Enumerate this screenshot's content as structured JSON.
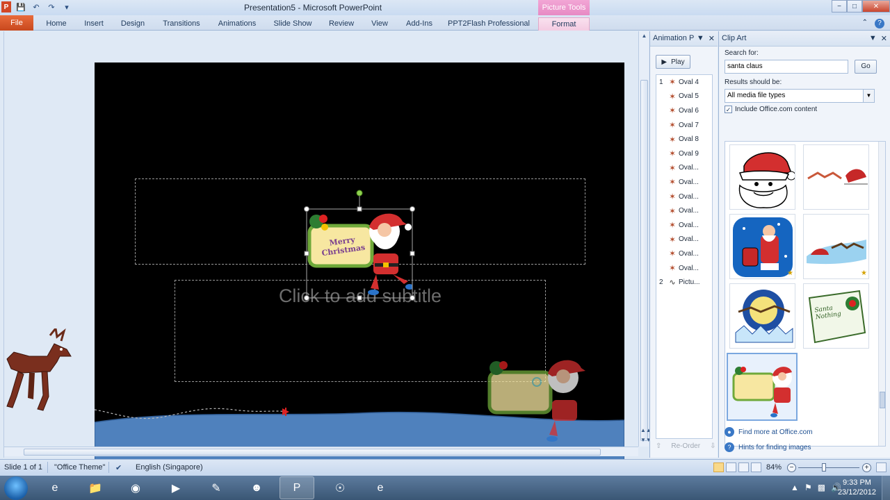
{
  "window": {
    "title": "Presentation5 - Microsoft PowerPoint",
    "contextual_tab_group": "Picture Tools",
    "minimize": "−",
    "maximize": "□",
    "close": "✕"
  },
  "ribbon": {
    "file": "File",
    "tabs": [
      "Home",
      "Insert",
      "Design",
      "Transitions",
      "Animations",
      "Slide Show",
      "Review",
      "View",
      "Add-Ins",
      "PPT2Flash Professional"
    ],
    "format_tab": "Format"
  },
  "slide": {
    "subtitle_placeholder": "Click to add subtitle",
    "clip_text": "Merry Christmas"
  },
  "animation_pane": {
    "title": "Animation P",
    "play": "Play",
    "items": [
      {
        "num": "1",
        "label": "Oval 4",
        "kind": "star"
      },
      {
        "num": "",
        "label": "Oval 5",
        "kind": "star"
      },
      {
        "num": "",
        "label": "Oval 6",
        "kind": "star"
      },
      {
        "num": "",
        "label": "Oval 7",
        "kind": "star"
      },
      {
        "num": "",
        "label": "Oval 8",
        "kind": "star"
      },
      {
        "num": "",
        "label": "Oval 9",
        "kind": "star"
      },
      {
        "num": "",
        "label": "Oval...",
        "kind": "star"
      },
      {
        "num": "",
        "label": "Oval...",
        "kind": "star"
      },
      {
        "num": "",
        "label": "Oval...",
        "kind": "star"
      },
      {
        "num": "",
        "label": "Oval...",
        "kind": "star"
      },
      {
        "num": "",
        "label": "Oval...",
        "kind": "star"
      },
      {
        "num": "",
        "label": "Oval...",
        "kind": "star"
      },
      {
        "num": "",
        "label": "Oval...",
        "kind": "star"
      },
      {
        "num": "",
        "label": "Oval...",
        "kind": "star"
      },
      {
        "num": "2",
        "label": "Pictu...",
        "kind": "path"
      }
    ],
    "reorder": "Re-Order"
  },
  "clip_art": {
    "title": "Clip Art",
    "search_label": "Search for:",
    "search_value": "santa claus",
    "go": "Go",
    "results_label": "Results should be:",
    "media_type": "All media file types",
    "include_office": "Include Office.com content",
    "include_checked": true,
    "find_more": "Find more at Office.com",
    "hints": "Hints for finding images",
    "tile_texts": {
      "santa_nothing": "Santa Nothing"
    }
  },
  "status": {
    "slide": "Slide 1 of 1",
    "theme": "\"Office Theme\"",
    "language": "English (Singapore)",
    "zoom": "84%"
  },
  "taskbar": {
    "time": "9:33 PM",
    "date": "23/12/2012"
  }
}
